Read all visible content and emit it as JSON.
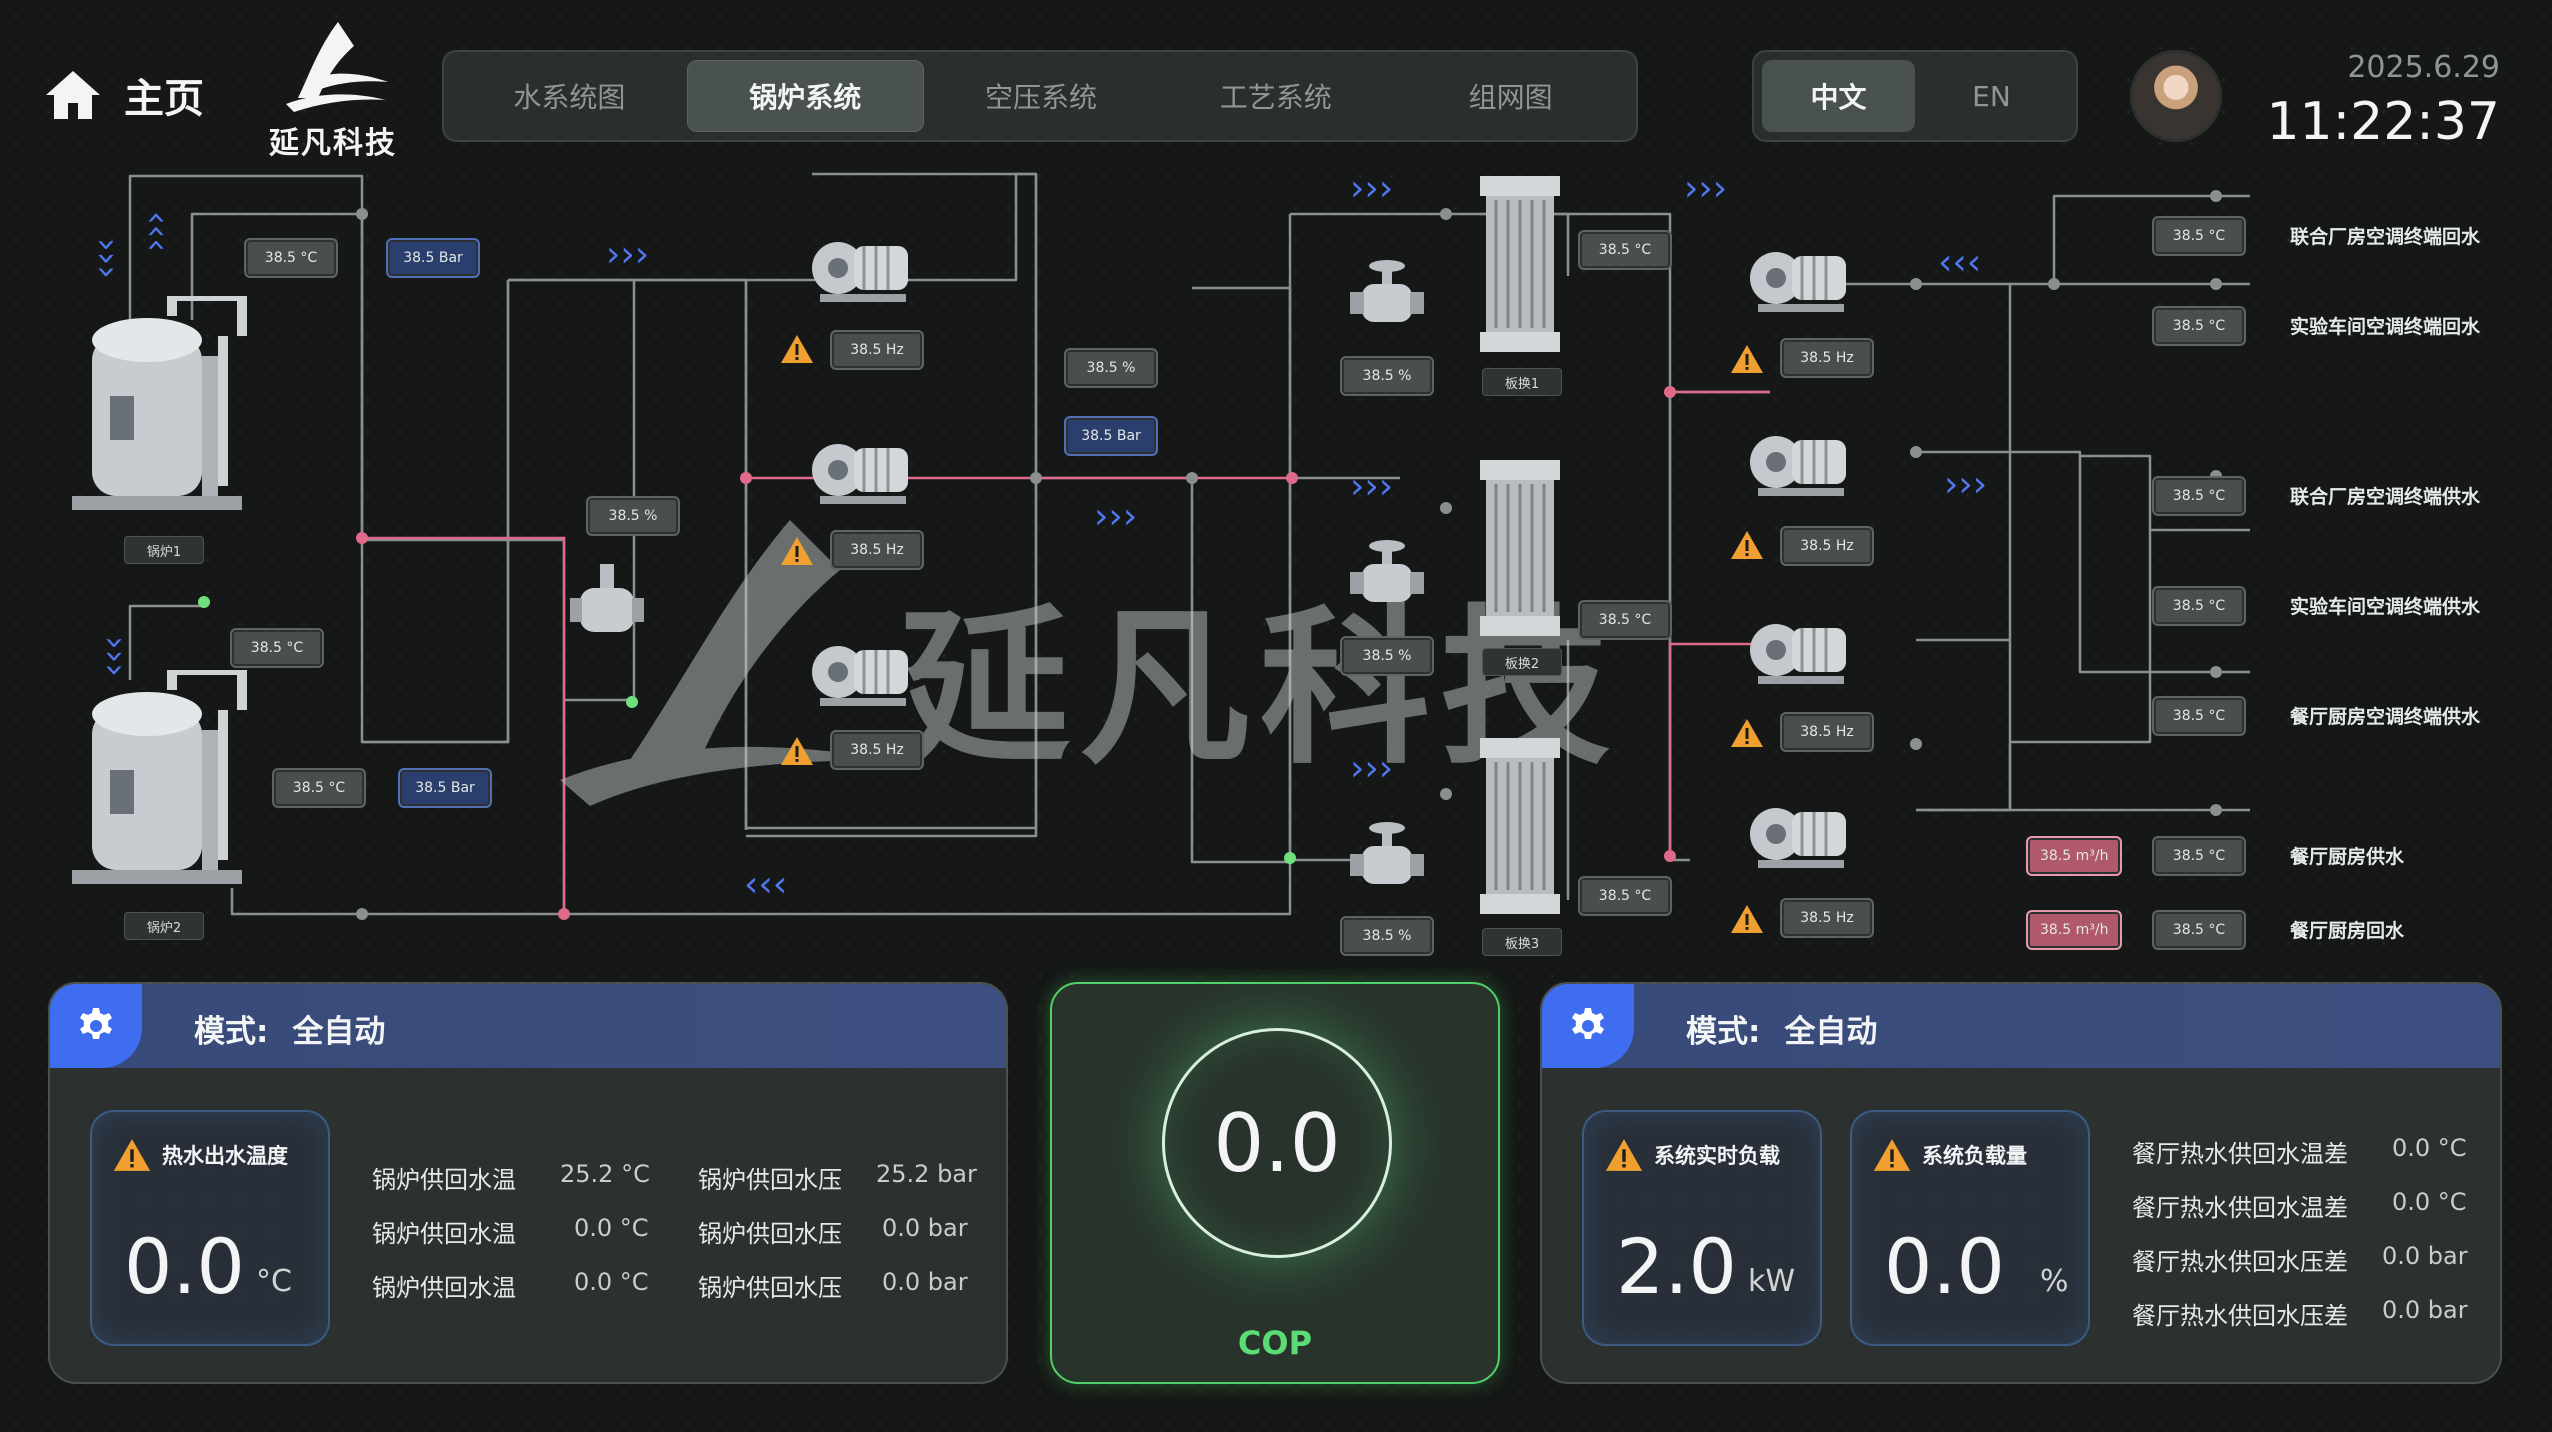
{
  "header": {
    "home_label": "主页",
    "logo_text": "延凡科技",
    "nav_tabs": [
      "水系统图",
      "锅炉系统",
      "空压系统",
      "工艺系统",
      "组网图"
    ],
    "active_tab": "锅炉系统",
    "lang_options": [
      "中文",
      "EN"
    ],
    "active_lang": "中文",
    "date": "2025.6.29",
    "time": "11:22:37"
  },
  "watermark": "延凡科技",
  "diagram": {
    "boilers": [
      "锅炉1",
      "锅炉2"
    ],
    "exchangers": [
      "板换1",
      "板换2",
      "板换3"
    ],
    "b1_temp": "38.5 °C",
    "b1_pressure": "38.5 Bar",
    "b2_temp_top": "38.5 °C",
    "b2_temp": "38.5 °C",
    "b2_pressure": "38.5 Bar",
    "valve_pct": "38.5 %",
    "pump_hz_1": "38.5 Hz",
    "pump_hz_2": "38.5 Hz",
    "pump_hz_3": "38.5 Hz",
    "mid_pct": "38.5 %",
    "mid_pressure": "38.5 Bar",
    "valve1_pct": "38.5 %",
    "valve2_pct": "38.5 %",
    "valve3_pct": "38.5 %",
    "hx1_temp": "38.5 °C",
    "hx2_temp": "38.5 °C",
    "hx3_temp": "38.5 °C",
    "right_pump_hz": [
      "38.5 Hz",
      "38.5 Hz",
      "38.5 Hz",
      "38.5 Hz"
    ],
    "outputs": [
      {
        "temp": "38.5 °C",
        "label": "联合厂房空调终端回水"
      },
      {
        "temp": "38.5 °C",
        "label": "实验车间空调终端回水"
      },
      {
        "temp": "38.5 °C",
        "label": "联合厂房空调终端供水"
      },
      {
        "temp": "38.5 °C",
        "label": "实验车间空调终端供水"
      },
      {
        "temp": "38.5 °C",
        "label": "餐厅厨房空调终端供水"
      },
      {
        "temp": "38.5 °C",
        "label": "餐厅厨房供水",
        "flow": "38.5 m³/h"
      },
      {
        "temp": "38.5 °C",
        "label": "餐厅厨房回水",
        "flow": "38.5 m³/h"
      }
    ]
  },
  "left_panel": {
    "mode_label": "模式:",
    "mode_value": "全自动",
    "card_title": "热水出水温度",
    "card_value": "0.0",
    "card_unit": "°C",
    "rows": [
      {
        "l1": "锅炉供回水温",
        "v1": "25.2 °C",
        "l2": "锅炉供回水压",
        "v2": "25.2 bar"
      },
      {
        "l1": "锅炉供回水温",
        "v1": "0.0 °C",
        "l2": "锅炉供回水压",
        "v2": "0.0  bar"
      },
      {
        "l1": "锅炉供回水温",
        "v1": "0.0 °C",
        "l2": "锅炉供回水压",
        "v2": "0.0  bar"
      }
    ]
  },
  "cop": {
    "value": "0.0",
    "label": "COP"
  },
  "right_panel": {
    "mode_label": "模式:",
    "mode_value": "全自动",
    "card1": {
      "title": "系统实时负载",
      "value": "2.0",
      "unit": "kW"
    },
    "card2": {
      "title": "系统负载量",
      "value": "0.0",
      "unit": "%"
    },
    "rows": [
      {
        "label": "餐厅热水供回水温差",
        "value": "0.0 °C"
      },
      {
        "label": "餐厅热水供回水温差",
        "value": "0.0 °C"
      },
      {
        "label": "餐厅热水供回水压差",
        "value": "0.0 bar"
      },
      {
        "label": "餐厅热水供回水压差",
        "value": "0.0 bar"
      }
    ]
  },
  "colors": {
    "accent_blue": "#3f6df0",
    "cop_green": "#4fd06a",
    "pipe_gray": "#8a908f",
    "pipe_pink": "#e06a8a",
    "warning": "#f0a030"
  }
}
